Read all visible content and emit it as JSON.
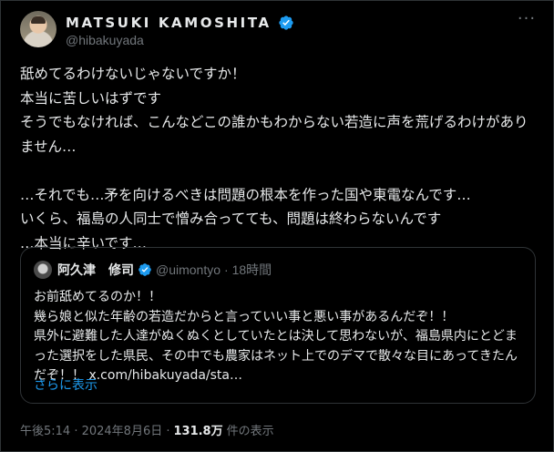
{
  "author": {
    "display_name": "MATSUKI KAMOSHITA",
    "handle": "@hibakuyada"
  },
  "tweet_text": "舐めてるわけないじゃないですか！\n本当に苦しいはずです\nそうでもなければ、こんなどこの誰かもわからない若造に声を荒げるわけがありません…\n\n…それでも…矛を向けるべきは問題の根本を作った国や東電なんです…\nいくら、福島の人同士で憎み合ってても、問題は終わらないんです\n…本当に辛いです…",
  "quote": {
    "name": "阿久津　修司",
    "handle": "@uimontyo",
    "time": "· 18時間",
    "text": "お前舐めてるのか！！\n幾ら娘と似た年齢の若造だからと言っていい事と悪い事があるんだぞ！！\n県外に避難した人達がぬくぬくとしていたとは決して思わないが、福島県内にとどまった選択をした県民、その中でも農家はネット上でのデマで散々な目にあってきたんだぞ！！ x.com/hibakuyada/sta…",
    "show_more": "さらに表示"
  },
  "meta": {
    "time": "午後5:14 · 2024年8月6日 ·",
    "views_count": "131.8万",
    "views_label": "件の表示"
  },
  "colors": {
    "background": "#000000",
    "text": "#e7e9ea",
    "secondary": "#71767b",
    "accent": "#1d9bf0",
    "border": "#2f3336"
  },
  "icons": {
    "verified": "verified-badge-icon",
    "more": "more-options-icon"
  }
}
